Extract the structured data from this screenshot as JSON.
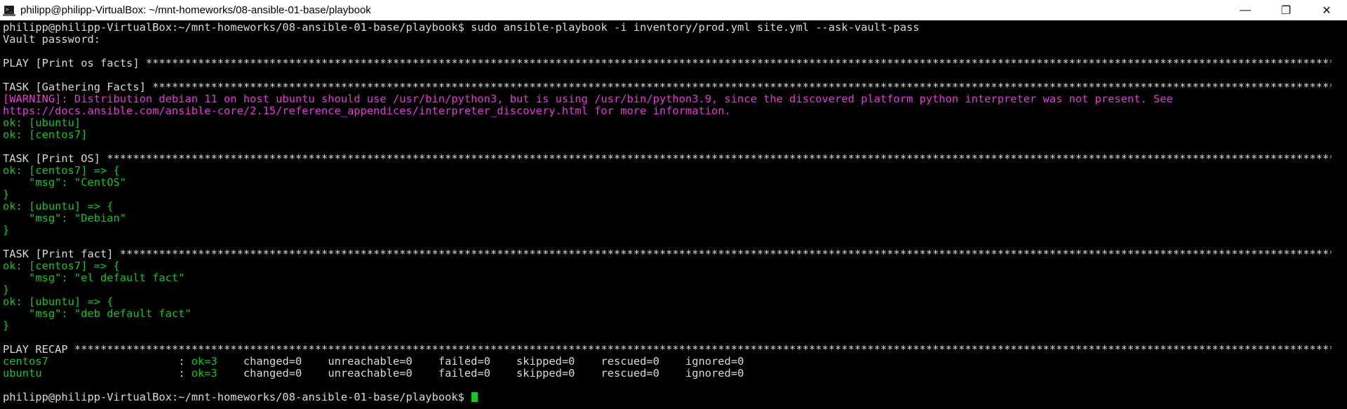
{
  "window": {
    "title": "philipp@philipp-VirtualBox: ~/mnt-homeworks/08-ansible-01-base/playbook",
    "minimize_glyph": "—",
    "maximize_glyph": "❐",
    "close_glyph": "✕"
  },
  "terminal": {
    "colors": {
      "background": "#000000",
      "text": "#d9d9d9",
      "ok": "#13c62a",
      "warning": "#e63bd9"
    },
    "lines": [
      [
        {
          "c": "w",
          "t": "philipp@philipp-VirtualBox:~/mnt-homeworks/08-ansible-01-base/playbook$ sudo ansible-playbook -i inventory/prod.yml site.yml --ask-vault-pass"
        }
      ],
      [
        {
          "c": "w",
          "t": "Vault password:"
        }
      ],
      [
        {
          "c": "w",
          "t": ""
        }
      ],
      [
        {
          "c": "w",
          "t": "PLAY [Print os facts] **********************************************************************************************************************************************************************************************************************************************"
        }
      ],
      [
        {
          "c": "w",
          "t": ""
        }
      ],
      [
        {
          "c": "w",
          "t": "TASK [Gathering Facts] *********************************************************************************************************************************************************************************************************************************************"
        }
      ],
      [
        {
          "c": "m",
          "t": "[WARNING]: Distribution debian 11 on host ubuntu should use /usr/bin/python3, but is using /usr/bin/python3.9, since the discovered platform python interpreter was not present. See"
        }
      ],
      [
        {
          "c": "m",
          "t": "https://docs.ansible.com/ansible-core/2.15/reference_appendices/interpreter_discovery.html for more information."
        }
      ],
      [
        {
          "c": "g",
          "t": "ok: [ubuntu]"
        }
      ],
      [
        {
          "c": "g",
          "t": "ok: [centos7]"
        }
      ],
      [
        {
          "c": "w",
          "t": ""
        }
      ],
      [
        {
          "c": "w",
          "t": "TASK [Print OS] ****************************************************************************************************************************************************************************************************************************************************"
        }
      ],
      [
        {
          "c": "g",
          "t": "ok: [centos7] => {"
        }
      ],
      [
        {
          "c": "g",
          "t": "    \"msg\": \"CentOS\""
        }
      ],
      [
        {
          "c": "g",
          "t": "}"
        }
      ],
      [
        {
          "c": "g",
          "t": "ok: [ubuntu] => {"
        }
      ],
      [
        {
          "c": "g",
          "t": "    \"msg\": \"Debian\""
        }
      ],
      [
        {
          "c": "g",
          "t": "}"
        }
      ],
      [
        {
          "c": "w",
          "t": ""
        }
      ],
      [
        {
          "c": "w",
          "t": "TASK [Print fact] **************************************************************************************************************************************************************************************************************************************************"
        }
      ],
      [
        {
          "c": "g",
          "t": "ok: [centos7] => {"
        }
      ],
      [
        {
          "c": "g",
          "t": "    \"msg\": \"el default fact\""
        }
      ],
      [
        {
          "c": "g",
          "t": "}"
        }
      ],
      [
        {
          "c": "g",
          "t": "ok: [ubuntu] => {"
        }
      ],
      [
        {
          "c": "g",
          "t": "    \"msg\": \"deb default fact\""
        }
      ],
      [
        {
          "c": "g",
          "t": "}"
        }
      ],
      [
        {
          "c": "w",
          "t": ""
        }
      ],
      [
        {
          "c": "w",
          "t": "PLAY RECAP *********************************************************************************************************************************************************************************************************************************************************"
        }
      ],
      [
        {
          "c": "g",
          "t": "centos7"
        },
        {
          "c": "w",
          "t": "                    : "
        },
        {
          "c": "g",
          "t": "ok=3"
        },
        {
          "c": "w",
          "t": "    changed=0    unreachable=0    failed=0    skipped=0    rescued=0    ignored=0"
        }
      ],
      [
        {
          "c": "g",
          "t": "ubuntu"
        },
        {
          "c": "w",
          "t": "                     : "
        },
        {
          "c": "g",
          "t": "ok=3"
        },
        {
          "c": "w",
          "t": "    changed=0    unreachable=0    failed=0    skipped=0    rescued=0    ignored=0"
        }
      ],
      [
        {
          "c": "w",
          "t": ""
        }
      ],
      [
        {
          "c": "w",
          "t": "philipp@philipp-VirtualBox:~/mnt-homeworks/08-ansible-01-base/playbook$ "
        }
      ]
    ]
  }
}
